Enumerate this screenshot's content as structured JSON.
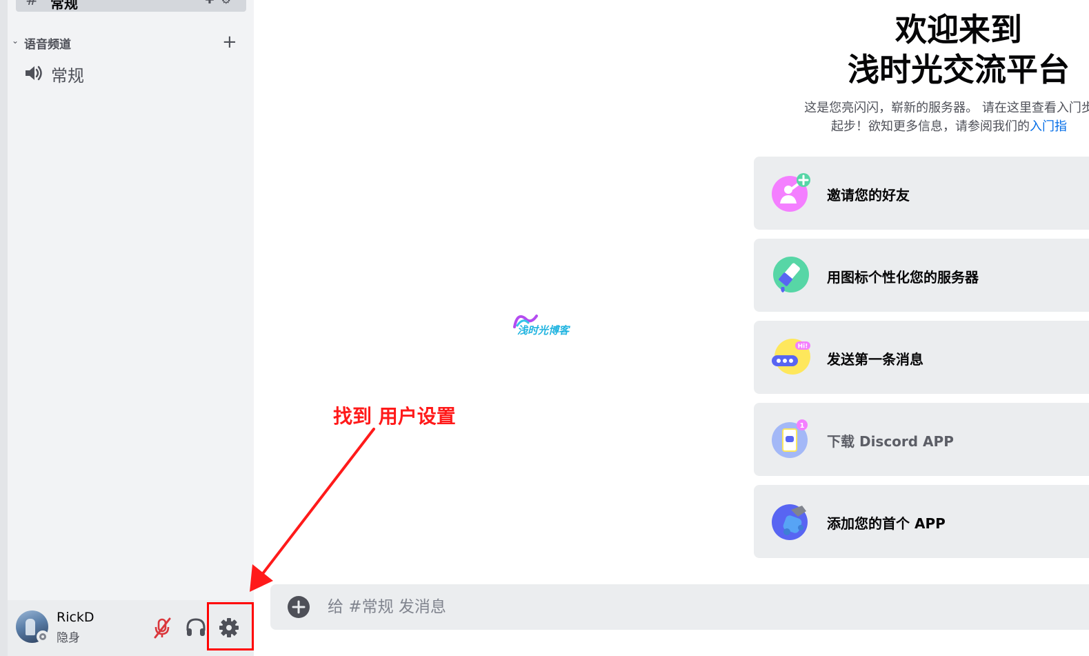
{
  "sidebar": {
    "selected_channel": {
      "hash": "#",
      "name": "常规"
    },
    "voice_category": {
      "label": "语音频道",
      "chevron": "chevron-down-icon",
      "add_icon": "plus-icon"
    },
    "voice_channels": [
      {
        "name": "常规",
        "icon": "speaker-icon"
      }
    ]
  },
  "user_panel": {
    "username": "RickD",
    "status": "隐身",
    "status_indicator": "invisible",
    "buttons": [
      "mute-microphone-icon",
      "headset-icon",
      "gear-icon"
    ],
    "mute_color": "#da373c"
  },
  "annotation": {
    "text": "找到 用户设置",
    "color": "#ff1a1a"
  },
  "watermark": {
    "text": "浅时光博客"
  },
  "welcome": {
    "title_line1": "欢迎来到",
    "title_line2": "浅时光交流平台",
    "desc_line1": "这是您亮闪闪，崭新的服务器。 请在这里查看入门步",
    "desc_line2_prefix": "起步！欲知更多信息，请参阅我们的",
    "desc_link": "入门指",
    "link_color": "#006ce7"
  },
  "actions": [
    {
      "label": "邀请您的好友",
      "icon": "invite-friends-icon",
      "color": "#f47fff"
    },
    {
      "label": "用图标个性化您的服务器",
      "icon": "paintbrush-icon",
      "color": "#57d6a6"
    },
    {
      "label": "发送第一条消息",
      "icon": "chat-bubble-icon",
      "color": "#fee75c"
    },
    {
      "label": "下载 Discord APP",
      "icon": "phone-download-icon",
      "color": "#7c9cf5",
      "muted": true,
      "badge": "1"
    },
    {
      "label": "添加您的首个 APP",
      "icon": "app-wrench-icon",
      "color": "#5865f2"
    }
  ],
  "composer": {
    "placeholder": "给 #常规 发消息",
    "add_icon": "plus-circle-icon"
  }
}
